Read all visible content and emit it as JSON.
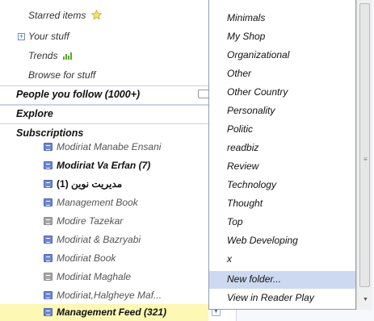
{
  "nav": {
    "starred": "Starred items",
    "your_stuff": "Your stuff",
    "trends": "Trends",
    "browse": "Browse for stuff",
    "expand_symbol": "+"
  },
  "sections": {
    "people": "People you follow (1000+)",
    "explore": "Explore",
    "subscriptions": "Subscriptions"
  },
  "feeds": [
    {
      "label": "Modiriat Manabe Ensani",
      "bold": false,
      "icon": "feed-icon"
    },
    {
      "label": "Modiriat Va Erfan (7)",
      "bold": true,
      "icon": "feed-icon"
    },
    {
      "label": "(مدیریت نوین (1",
      "bold": true,
      "icon": "feed-icon"
    },
    {
      "label": "Management Book",
      "bold": false,
      "icon": "feed-icon"
    },
    {
      "label": "Modire Tazekar",
      "bold": false,
      "icon": "broken-feed-icon"
    },
    {
      "label": "Modiriat & Bazryabi",
      "bold": false,
      "icon": "feed-icon"
    },
    {
      "label": "Modiriat Book",
      "bold": false,
      "icon": "feed-icon"
    },
    {
      "label": "Modiriat Maghale",
      "bold": false,
      "icon": "broken-feed-icon"
    },
    {
      "label": "Modiriat,Halgheye Maf...",
      "bold": false,
      "icon": "feed-icon"
    },
    {
      "label": "Management Feed (321)",
      "bold": true,
      "icon": "feed-icon",
      "selected": true
    }
  ],
  "menu": {
    "items": [
      "Minimals",
      "My Shop",
      "Organizational",
      "Other",
      "Other Country",
      "Personality",
      "Politic",
      "readbiz",
      "Review",
      "Technology",
      "Thought",
      "Top",
      "Web Developing",
      "x",
      "New folder...",
      "View in Reader Play"
    ],
    "highlighted": "New folder..."
  },
  "scroll": {
    "down_arrow": "▼",
    "grip": "≡"
  },
  "colors": {
    "selected_row": "#fdf8b4",
    "menu_highlight": "#cdd9f1",
    "feed_icon": "#6e86d3",
    "trend_green": "#5aa82a",
    "star": "#e9d24a"
  }
}
